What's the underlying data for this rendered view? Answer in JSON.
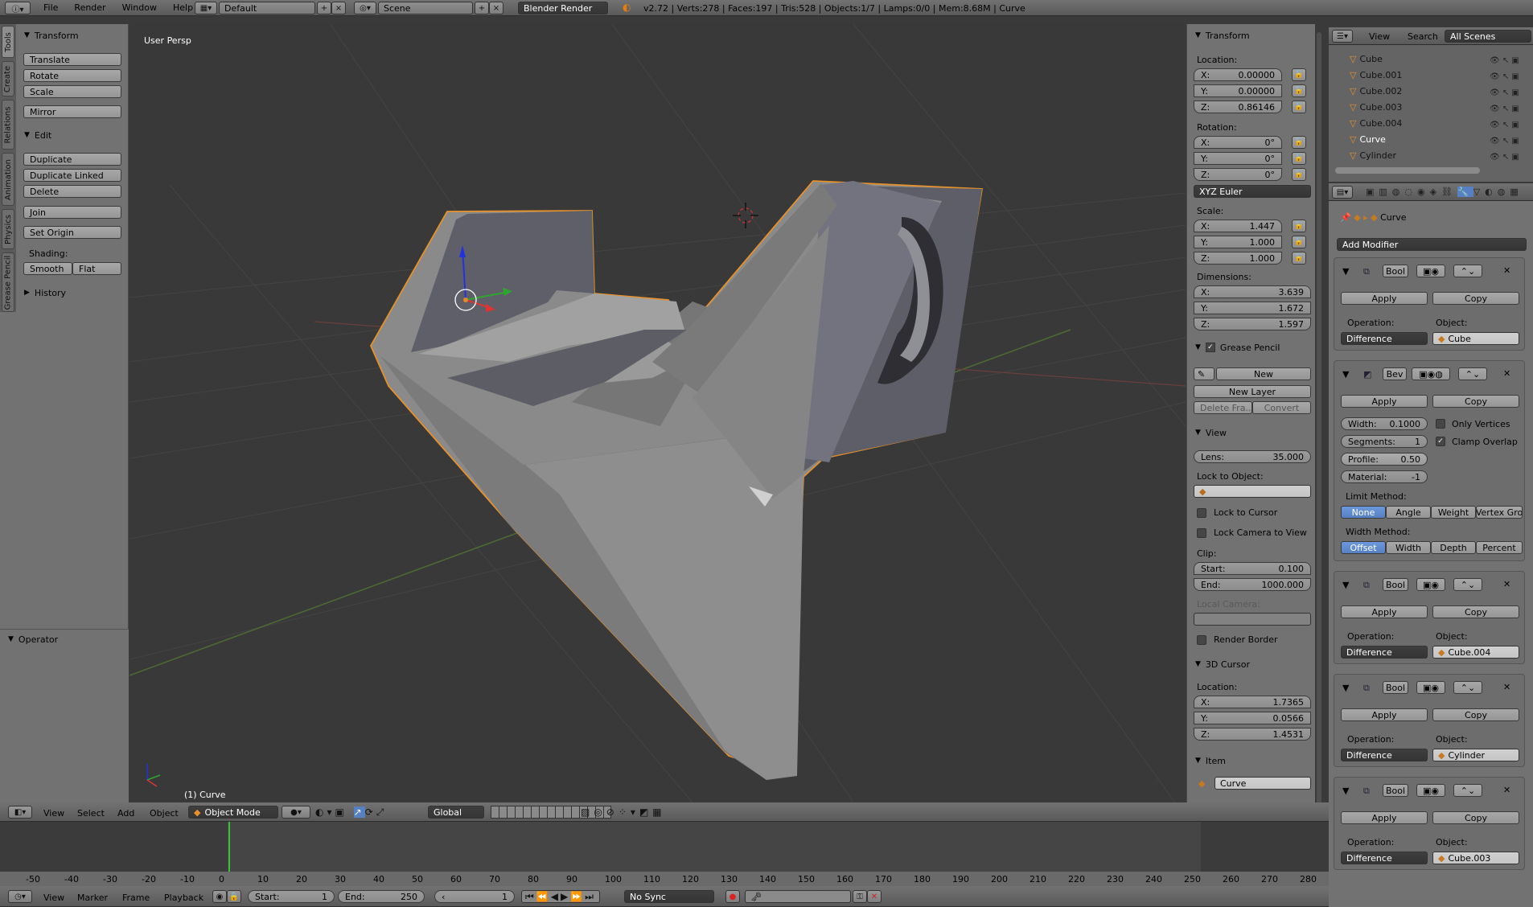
{
  "topbar": {
    "menus": [
      "File",
      "Render",
      "Window",
      "Help"
    ],
    "layout": "Default",
    "scene": "Scene",
    "engine": "Blender Render",
    "stats": "v2.72 | Verts:278 | Faces:197 | Tris:528 | Objects:1/7 | Lamps:0/0 | Mem:8.68M | Curve"
  },
  "vtabs": [
    "Tools",
    "Create",
    "Relations",
    "Animation",
    "Physics",
    "Grease Pencil"
  ],
  "tools": {
    "transform_title": "Transform",
    "translate": "Translate",
    "rotate": "Rotate",
    "scale": "Scale",
    "mirror": "Mirror",
    "edit_title": "Edit",
    "duplicate": "Duplicate",
    "duplicate_linked": "Duplicate Linked",
    "delete": "Delete",
    "join": "Join",
    "set_origin": "Set Origin",
    "shading_label": "Shading:",
    "smooth": "Smooth",
    "flat": "Flat",
    "history_title": "History",
    "operator_title": "Operator"
  },
  "viewport": {
    "persp": "User Persp",
    "object_label": "(1) Curve"
  },
  "props": {
    "transform_title": "Transform",
    "location_label": "Location:",
    "loc_x": "0.00000",
    "loc_y": "0.00000",
    "loc_z": "0.86146",
    "rotation_label": "Rotation:",
    "rot_x": "0°",
    "rot_y": "0°",
    "rot_z": "0°",
    "rot_mode": "XYZ Euler",
    "scale_label": "Scale:",
    "scl_x": "1.447",
    "scl_y": "1.000",
    "scl_z": "1.000",
    "dimensions_label": "Dimensions:",
    "dim_x": "3.639",
    "dim_y": "1.672",
    "dim_z": "1.597",
    "gp_title": "Grease Pencil",
    "gp_new": "New",
    "gp_new_layer": "New Layer",
    "gp_delete": "Delete Fra...",
    "gp_convert": "Convert",
    "view_title": "View",
    "lens_label": "Lens:",
    "lens": "35.000",
    "lock_obj_label": "Lock to Object:",
    "lock_cursor": "Lock to Cursor",
    "lock_camera": "Lock Camera to View",
    "clip_label": "Clip:",
    "clip_start_label": "Start:",
    "clip_start": "0.100",
    "clip_end_label": "End:",
    "clip_end": "1000.000",
    "local_camera": "Local Camera:",
    "render_border": "Render Border",
    "cursor_title": "3D Cursor",
    "cursor_loc": "Location:",
    "cur_x": "1.7365",
    "cur_y": "0.0566",
    "cur_z": "1.4531",
    "item_title": "Item",
    "item_name": "Curve"
  },
  "outliner": {
    "view": "View",
    "search": "Search",
    "all_scenes": "All Scenes",
    "items": [
      "Cube",
      "Cube.001",
      "Cube.002",
      "Cube.003",
      "Cube.004",
      "Curve",
      "Cylinder"
    ]
  },
  "modifiers": {
    "breadcrumb": "Curve",
    "add_modifier": "Add Modifier",
    "apply": "Apply",
    "copy": "Copy",
    "operation_label": "Operation:",
    "object_label": "Object:",
    "difference": "Difference",
    "bool_name": "Bool",
    "bev_name": "Bev",
    "bool_objects": [
      "Cube",
      "Cube.004",
      "Cylinder",
      "Cube.003"
    ],
    "bev": {
      "width": "Width:",
      "width_val": "0.1000",
      "segments": "Segments:",
      "segments_val": "1",
      "profile": "Profile:",
      "profile_val": "0.50",
      "material": "Material:",
      "material_val": "-1",
      "only_vertices": "Only Vertices",
      "clamp_overlap": "Clamp Overlap",
      "limit_method": "Limit Method:",
      "limit_opts": [
        "None",
        "Angle",
        "Weight",
        "Vertex Gro"
      ],
      "width_method": "Width Method:",
      "width_opts": [
        "Offset",
        "Width",
        "Depth",
        "Percent"
      ]
    }
  },
  "view3d_header": {
    "menus": [
      "View",
      "Select",
      "Add",
      "Object"
    ],
    "mode": "Object Mode",
    "orientation": "Global"
  },
  "timeline": {
    "ticks": [
      "-50",
      "-40",
      "-30",
      "-20",
      "-10",
      "0",
      "10",
      "20",
      "30",
      "40",
      "50",
      "60",
      "70",
      "80",
      "90",
      "100",
      "110",
      "120",
      "130",
      "140",
      "150",
      "160",
      "170",
      "180",
      "190",
      "200",
      "210",
      "220",
      "230",
      "240",
      "250",
      "260",
      "270",
      "280"
    ],
    "menus": [
      "View",
      "Marker",
      "Frame",
      "Playback"
    ],
    "start_label": "Start:",
    "start": "1",
    "end_label": "End:",
    "end": "250",
    "current": "1",
    "sync": "No Sync"
  }
}
